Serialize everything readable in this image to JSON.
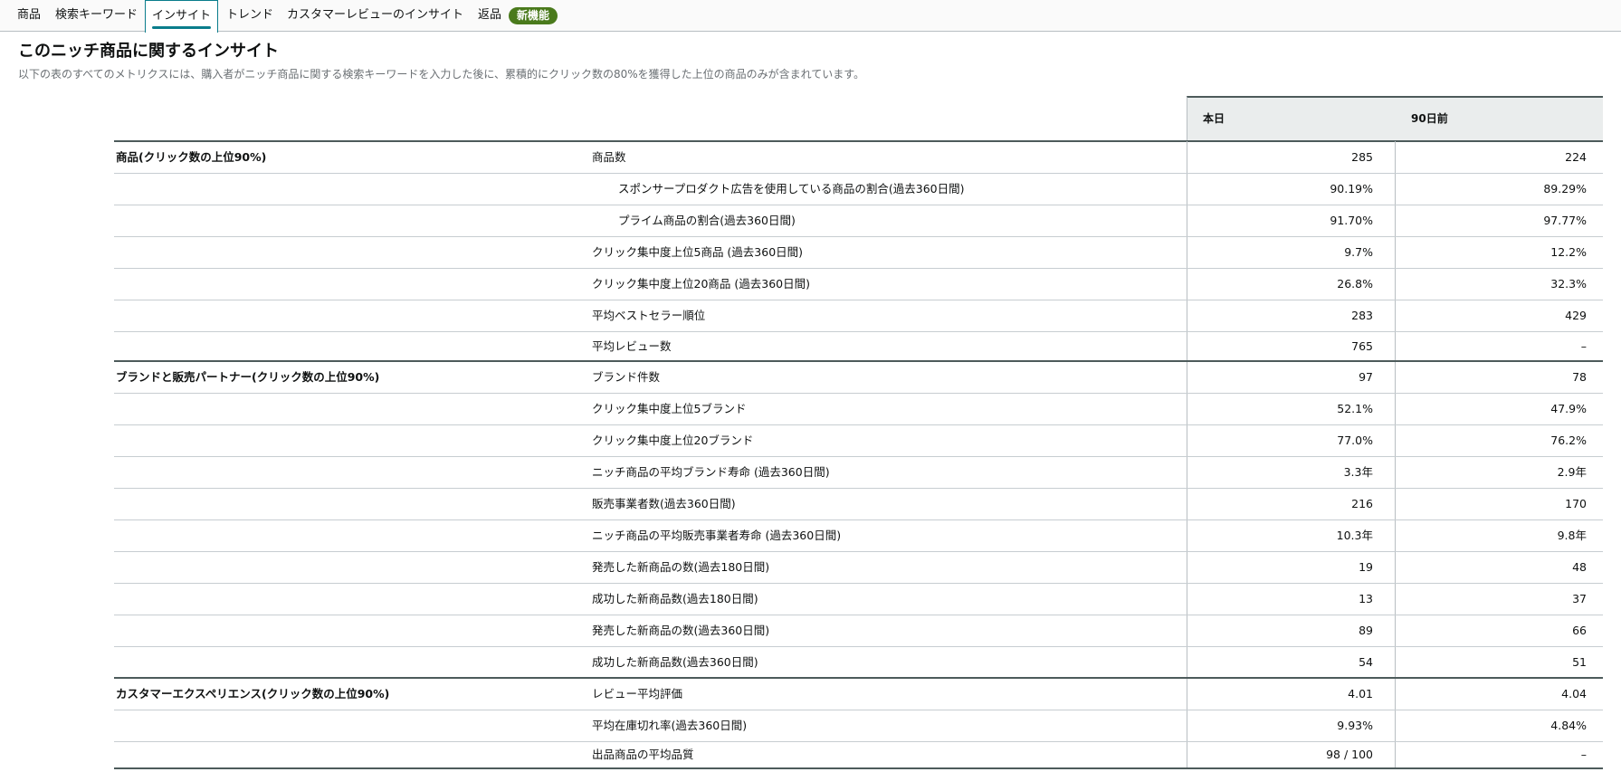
{
  "tabs": [
    {
      "label": "商品",
      "active": false
    },
    {
      "label": "検索キーワード",
      "active": false
    },
    {
      "label": "インサイト",
      "active": true
    },
    {
      "label": "トレンド",
      "active": false
    },
    {
      "label": "カスタマーレビューのインサイト",
      "active": false
    },
    {
      "label": "返品",
      "active": false
    }
  ],
  "new_badge": "新機能",
  "page": {
    "title": "このニッチ商品に関するインサイト",
    "subtitle": "以下の表のすべてのメトリクスには、購入者がニッチ商品に関する検索キーワードを入力した後に、累積的にクリック数の80%を獲得した上位の商品のみが含まれています。"
  },
  "columns": {
    "today": "本日",
    "prev": "90日前"
  },
  "rows": [
    {
      "group": "商品(クリック数の上位90%)",
      "metric": "商品数",
      "sub": false,
      "today": "285",
      "prev": "224",
      "end_group": false
    },
    {
      "group": "",
      "metric": "スポンサープロダクト広告を使用している商品の割合(過去360日間)",
      "sub": true,
      "today": "90.19%",
      "prev": "89.29%",
      "end_group": false
    },
    {
      "group": "",
      "metric": "プライム商品の割合(過去360日間)",
      "sub": true,
      "today": "91.70%",
      "prev": "97.77%",
      "end_group": false
    },
    {
      "group": "",
      "metric": "クリック集中度上位5商品 (過去360日間)",
      "sub": false,
      "today": "9.7%",
      "prev": "12.2%",
      "end_group": false
    },
    {
      "group": "",
      "metric": "クリック集中度上位20商品 (過去360日間)",
      "sub": false,
      "today": "26.8%",
      "prev": "32.3%",
      "end_group": false
    },
    {
      "group": "",
      "metric": "平均ベストセラー順位",
      "sub": false,
      "today": "283",
      "prev": "429",
      "end_group": false
    },
    {
      "group": "",
      "metric": "平均レビュー数",
      "sub": false,
      "today": "765",
      "prev": "–",
      "end_group": true
    },
    {
      "group": "ブランドと販売パートナー(クリック数の上位90%)",
      "metric": "ブランド件数",
      "sub": false,
      "today": "97",
      "prev": "78",
      "end_group": false
    },
    {
      "group": "",
      "metric": "クリック集中度上位5ブランド",
      "sub": false,
      "today": "52.1%",
      "prev": "47.9%",
      "end_group": false
    },
    {
      "group": "",
      "metric": "クリック集中度上位20ブランド",
      "sub": false,
      "today": "77.0%",
      "prev": "76.2%",
      "end_group": false
    },
    {
      "group": "",
      "metric": "ニッチ商品の平均ブランド寿命 (過去360日間)",
      "sub": false,
      "today": "3.3年",
      "prev": "2.9年",
      "end_group": false
    },
    {
      "group": "",
      "metric": "販売事業者数(過去360日間)",
      "sub": false,
      "today": "216",
      "prev": "170",
      "end_group": false
    },
    {
      "group": "",
      "metric": "ニッチ商品の平均販売事業者寿命 (過去360日間)",
      "sub": false,
      "today": "10.3年",
      "prev": "9.8年",
      "end_group": false
    },
    {
      "group": "",
      "metric": "発売した新商品の数(過去180日間)",
      "sub": false,
      "today": "19",
      "prev": "48",
      "end_group": false
    },
    {
      "group": "",
      "metric": "成功した新商品数(過去180日間)",
      "sub": false,
      "today": "13",
      "prev": "37",
      "end_group": false
    },
    {
      "group": "",
      "metric": "発売した新商品の数(過去360日間)",
      "sub": false,
      "today": "89",
      "prev": "66",
      "end_group": false
    },
    {
      "group": "",
      "metric": "成功した新商品数(過去360日間)",
      "sub": false,
      "today": "54",
      "prev": "51",
      "end_group": true
    },
    {
      "group": "カスタマーエクスペリエンス(クリック数の上位90%)",
      "metric": "レビュー平均評価",
      "sub": false,
      "today": "4.01",
      "prev": "4.04",
      "end_group": false
    },
    {
      "group": "",
      "metric": "平均在庫切れ率(過去360日間)",
      "sub": false,
      "today": "9.93%",
      "prev": "4.84%",
      "end_group": false
    },
    {
      "group": "",
      "metric": "出品商品の平均品質",
      "sub": false,
      "today": "98 / 100",
      "prev": "–",
      "end_group": true
    }
  ]
}
